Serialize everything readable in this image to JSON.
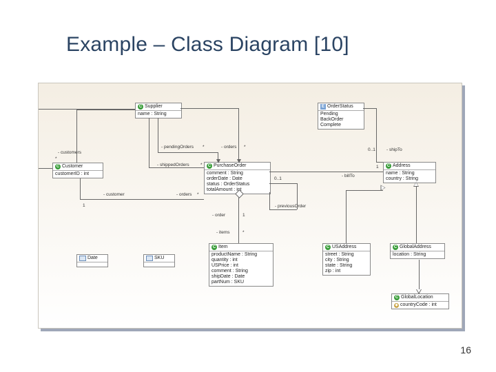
{
  "slide": {
    "title": "Example – Class Diagram [10]",
    "page_number": "16"
  },
  "classes": {
    "supplier": {
      "name": "Supplier",
      "attrs": [
        "name : String"
      ]
    },
    "orderstatus": {
      "name": "OrderStatus",
      "attrs": [
        "Pending",
        "BackOrder",
        "Complete"
      ]
    },
    "customer": {
      "name": "Customer",
      "attrs": [
        "customerID : int"
      ]
    },
    "purchaseorder": {
      "name": "PurchaseOrder",
      "attrs": [
        "comment : String",
        "orderDate : Date",
        "status : OrderStatus",
        "totalAmount : int"
      ]
    },
    "address": {
      "name": "Address",
      "attrs": [
        "name : String",
        "country : String"
      ]
    },
    "item": {
      "name": "Item",
      "attrs": [
        "productName : String",
        "quantity : int",
        "USPrice : int",
        "comment : String",
        "shipDate : Date",
        "partNum : SKU"
      ]
    },
    "usaddress": {
      "name": "USAddress",
      "attrs": [
        "street : String",
        "city : String",
        "state : String",
        "zip : int"
      ]
    },
    "globaladdress": {
      "name": "GlobalAddress",
      "attrs": [
        "location : String"
      ]
    },
    "globallocation": {
      "name": "GlobalLocation",
      "attrs": [
        "countryCode : int"
      ]
    },
    "date": {
      "name": "Date"
    },
    "sku": {
      "name": "SKU"
    }
  },
  "labels": {
    "customers_role": "- customers",
    "pendingOrders": "- pendingOrders",
    "shippedOrders": "- shippedOrders",
    "orders_role": "- orders",
    "customer_role": "- customer",
    "orders_role2": "- orders",
    "order_role": "- order",
    "items_role": "- items",
    "previousOrder": "- previousOrder",
    "shipTo": "- shipTo",
    "billTo": "- billTo",
    "m_star": "*",
    "m_one": "1",
    "m_0_1": "0..1",
    "bullet": "◇"
  },
  "icons": {
    "class_badge": "C",
    "enum_badge": "E"
  }
}
